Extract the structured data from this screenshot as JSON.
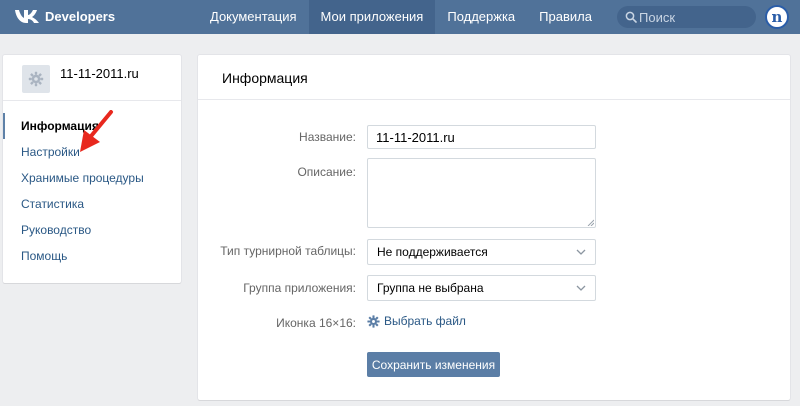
{
  "header": {
    "logo_text": "Developers",
    "nav": [
      {
        "label": "Документация"
      },
      {
        "label": "Мои приложения"
      },
      {
        "label": "Поддержка"
      },
      {
        "label": "Правила"
      }
    ],
    "search_placeholder": "Поиск",
    "user_initial": "n"
  },
  "sidebar": {
    "app_name": "11-11-2011.ru",
    "items": [
      {
        "label": "Информация"
      },
      {
        "label": "Настройки"
      },
      {
        "label": "Хранимые процедуры"
      },
      {
        "label": "Статистика"
      },
      {
        "label": "Руководство"
      },
      {
        "label": "Помощь"
      }
    ]
  },
  "main": {
    "title": "Информация",
    "name_label": "Название:",
    "name_value": "11-11-2011.ru",
    "description_label": "Описание:",
    "description_value": "",
    "tournament_label": "Тип турнирной таблицы:",
    "tournament_value": "Не поддерживается",
    "group_label": "Группа приложения:",
    "group_value": "Группа не выбрана",
    "icon_label": "Иконка 16×16:",
    "choose_file": "Выбрать файл",
    "save_label": "Сохранить изменения"
  },
  "colors": {
    "header": "#507299",
    "header_active": "#43648c",
    "link": "#2a5885",
    "button": "#5b7ea6",
    "annotation_arrow": "#e8281e"
  }
}
